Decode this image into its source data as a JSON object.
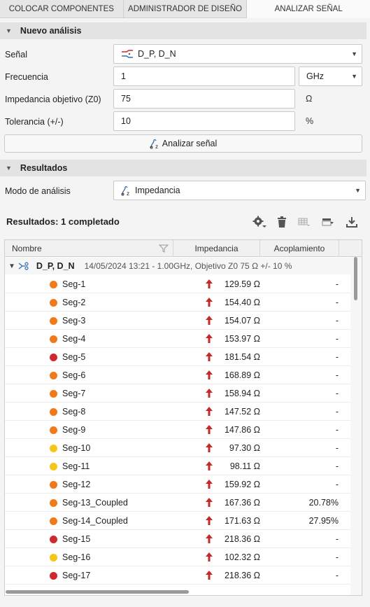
{
  "tabs": [
    {
      "label": "COLOCAR COMPONENTES"
    },
    {
      "label": "ADMINISTRADOR DE DISEÑO"
    },
    {
      "label": "ANALIZAR SEÑAL"
    }
  ],
  "new_analysis": {
    "title": "Nuevo análisis",
    "signal_label": "Señal",
    "signal_value": "D_P, D_N",
    "frequency_label": "Frecuencia",
    "frequency_value": "1",
    "frequency_unit": "GHz",
    "impedance_label": "Impedancia objetivo (Z0)",
    "impedance_value": "75",
    "impedance_unit": "Ω",
    "tolerance_label": "Tolerancia (+/-)",
    "tolerance_value": "10",
    "tolerance_unit": "%",
    "analyze_button": "Analizar señal"
  },
  "results_section": {
    "title": "Resultados",
    "mode_label": "Modo de análisis",
    "mode_value": "Impedancia"
  },
  "results": {
    "title": "Resultados: 1 completado",
    "columns": [
      "Nombre",
      "Impedancia",
      "Acoplamiento"
    ],
    "group": {
      "name": "D_P, D_N",
      "detail": "14/05/2024 13:21 - 1.00GHz, Objetivo Z0 75 Ω +/- 10 %"
    },
    "rows": [
      {
        "name": "Seg-1",
        "status_color": "#f07a1a",
        "impedance": "129.59 Ω",
        "coupling": "-"
      },
      {
        "name": "Seg-2",
        "status_color": "#f07a1a",
        "impedance": "154.40 Ω",
        "coupling": "-"
      },
      {
        "name": "Seg-3",
        "status_color": "#f07a1a",
        "impedance": "154.07 Ω",
        "coupling": "-"
      },
      {
        "name": "Seg-4",
        "status_color": "#f07a1a",
        "impedance": "153.97 Ω",
        "coupling": "-"
      },
      {
        "name": "Seg-5",
        "status_color": "#d0282e",
        "impedance": "181.54 Ω",
        "coupling": "-"
      },
      {
        "name": "Seg-6",
        "status_color": "#f07a1a",
        "impedance": "168.89 Ω",
        "coupling": "-"
      },
      {
        "name": "Seg-7",
        "status_color": "#f07a1a",
        "impedance": "158.94 Ω",
        "coupling": "-"
      },
      {
        "name": "Seg-8",
        "status_color": "#f07a1a",
        "impedance": "147.52 Ω",
        "coupling": "-"
      },
      {
        "name": "Seg-9",
        "status_color": "#f07a1a",
        "impedance": "147.86 Ω",
        "coupling": "-"
      },
      {
        "name": "Seg-10",
        "status_color": "#f5c518",
        "impedance": "97.30 Ω",
        "coupling": "-"
      },
      {
        "name": "Seg-11",
        "status_color": "#f5c518",
        "impedance": "98.11 Ω",
        "coupling": "-"
      },
      {
        "name": "Seg-12",
        "status_color": "#f07a1a",
        "impedance": "159.92 Ω",
        "coupling": "-"
      },
      {
        "name": "Seg-13_Coupled",
        "status_color": "#f07a1a",
        "impedance": "167.36 Ω",
        "coupling": "20.78%"
      },
      {
        "name": "Seg-14_Coupled",
        "status_color": "#f07a1a",
        "impedance": "171.63 Ω",
        "coupling": "27.95%"
      },
      {
        "name": "Seg-15",
        "status_color": "#d0282e",
        "impedance": "218.36 Ω",
        "coupling": "-"
      },
      {
        "name": "Seg-16",
        "status_color": "#f5c518",
        "impedance": "102.32 Ω",
        "coupling": "-"
      },
      {
        "name": "Seg-17",
        "status_color": "#d0282e",
        "impedance": "218.36 Ω",
        "coupling": "-"
      }
    ]
  },
  "colors": {
    "arrow_up": "#c62828",
    "accent": "#2f6fb5"
  }
}
